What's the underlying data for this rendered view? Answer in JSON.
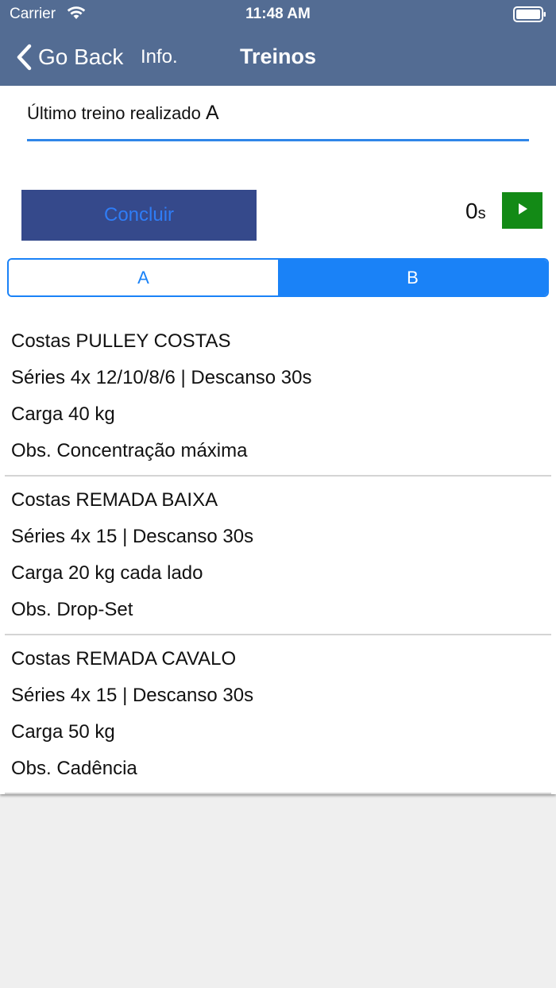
{
  "status_bar": {
    "carrier": "Carrier",
    "time": "11:48 AM"
  },
  "nav": {
    "back_label": "Go Back",
    "info_label": "Info.",
    "title": "Treinos"
  },
  "last_workout": {
    "label": "Último treino realizado",
    "value": "A"
  },
  "actions": {
    "conclude_label": "Concluir",
    "timer_value": "0",
    "timer_unit": "s"
  },
  "segments": {
    "a": "A",
    "b": "B",
    "selected": "B"
  },
  "exercises": [
    {
      "title": "Costas PULLEY COSTAS",
      "series": "Séries 4x 12/10/8/6 | Descanso 30s",
      "load": "Carga 40 kg",
      "obs": "Obs. Concentração máxima"
    },
    {
      "title": "Costas REMADA BAIXA",
      "series": "Séries 4x 15 | Descanso 30s",
      "load": "Carga 20 kg cada lado",
      "obs": "Obs. Drop-Set"
    },
    {
      "title": "Costas REMADA CAVALO",
      "series": "Séries 4x 15 | Descanso 30s",
      "load": "Carga 50 kg",
      "obs": "Obs. Cadência"
    }
  ],
  "colors": {
    "nav_bar": "#536c93",
    "conclude_bg": "#35498b",
    "accent_blue": "#1a82f7",
    "play_green": "#138a16"
  },
  "icons": [
    "wifi-icon",
    "battery-icon",
    "chevron-left-icon",
    "play-icon"
  ]
}
